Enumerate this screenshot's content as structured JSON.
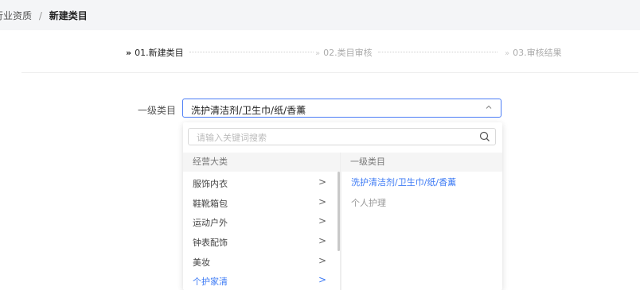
{
  "breadcrumb": {
    "parent": "行业资质",
    "separator": "/",
    "current": "新建类目"
  },
  "steps": [
    {
      "label": "01.新建类目",
      "prefix": "»"
    },
    {
      "label": "02.类目审核",
      "prefix": "»"
    },
    {
      "label": "03.审核结果",
      "prefix": "»"
    }
  ],
  "form": {
    "category_label": "一级类目",
    "category_value": "洗护清洁剂/卫生巾/纸/香薰"
  },
  "dropdown": {
    "search_placeholder": "请输入关键词搜索",
    "left_header": "经营大类",
    "right_header": "一级类目",
    "left_items": [
      {
        "label": "服饰内衣",
        "selected": false
      },
      {
        "label": "鞋靴箱包",
        "selected": false
      },
      {
        "label": "运动户外",
        "selected": false
      },
      {
        "label": "钟表配饰",
        "selected": false
      },
      {
        "label": "美妆",
        "selected": false
      },
      {
        "label": "个护家清",
        "selected": true
      }
    ],
    "right_items": [
      {
        "label": "洗护清洁剂/卫生巾/纸/香薰",
        "selected": true
      },
      {
        "label": "个人护理",
        "selected": false
      }
    ],
    "chevron": ">"
  },
  "colors": {
    "accent": "#3e7bf5",
    "border_focus": "#4a7cf6"
  }
}
